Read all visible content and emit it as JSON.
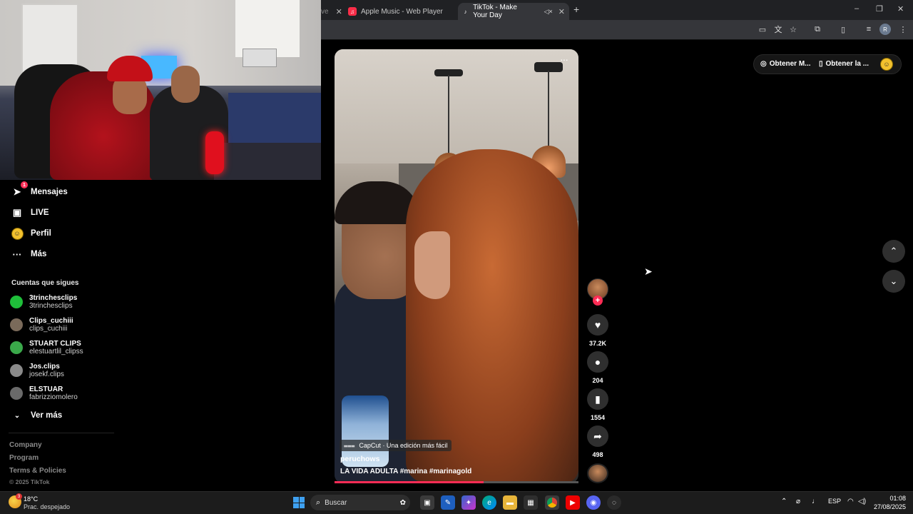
{
  "browser": {
    "tabs": [
      {
        "label": "",
        "partial": true
      },
      {
        "label": "Apple Music - Web Player"
      },
      {
        "label": "TikTok - Make Your Day",
        "active": true
      }
    ],
    "window_controls": [
      "–",
      "❐",
      "✕"
    ]
  },
  "sidebar": {
    "nav": [
      {
        "label": "Mensajes",
        "icon": "send-icon",
        "badge": "1"
      },
      {
        "label": "LIVE",
        "icon": "live-tv-icon"
      },
      {
        "label": "Perfil",
        "icon": "profile-avatar-icon"
      },
      {
        "label": "Más",
        "icon": "more-dots-icon"
      }
    ],
    "following_title": "Cuentas que sigues",
    "following": [
      {
        "name": "3trinchesclips",
        "handle": "3trinchesclips",
        "avatar_color": "#1fbf3a"
      },
      {
        "name": "Clips_cuchiii",
        "handle": "clips_cuchiii",
        "avatar_color": "#7a6a5a"
      },
      {
        "name": "STUART CLIPS",
        "handle": "elestuartlil_clipss",
        "avatar_color": "#3aa84a"
      },
      {
        "name": "Jos.clips",
        "handle": "josekf.clips",
        "avatar_color": "#8a8a8a"
      },
      {
        "name": "ELSTUAR",
        "handle": "fabrizziomolero",
        "avatar_color": "#6a6a6a"
      }
    ],
    "see_more": "Ver más",
    "footer_links": [
      "Company",
      "Program",
      "Terms & Policies"
    ],
    "copyright": "© 2025 TikTok"
  },
  "video": {
    "capcut_label": "CapCut · Una edición más fácil",
    "author": "peruchows",
    "caption": "LA VIDA ADULTA #marina  #marinagold",
    "progress": 0.61,
    "more": "···"
  },
  "actions": {
    "likes": "37.2K",
    "comments": "204",
    "saves": "1554",
    "shares": "498"
  },
  "top_bar": {
    "get_coins": "Obtener M...",
    "get_app": "Obtener la ..."
  },
  "taskbar": {
    "temp": "18°C",
    "weather": "Prac. despejado",
    "weather_badge": "3",
    "search_placeholder": "Buscar",
    "lang": "ESP",
    "time": "01:08",
    "date": "27/08/2025"
  },
  "colors": {
    "accent": "#fe2c55",
    "background": "#000000"
  }
}
